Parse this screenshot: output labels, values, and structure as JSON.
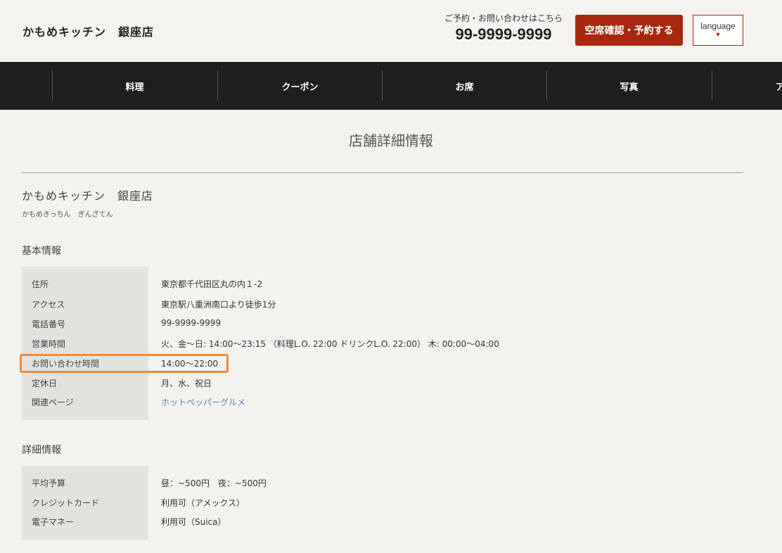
{
  "header": {
    "logo": "かもめキッチン　銀座店",
    "contact_label": "ご予約・お問い合わせはこちら",
    "phone": "99-9999-9999",
    "reserve_label": "空席確認・予約する",
    "language_label": "language",
    "language_caret": "▼"
  },
  "nav": {
    "items": [
      {
        "label": "料理"
      },
      {
        "label": "クーポン"
      },
      {
        "label": "お席"
      },
      {
        "label": "写真"
      },
      {
        "label": "ア"
      }
    ]
  },
  "main": {
    "page_title": "店舗詳細情報",
    "shop_name": "かもめキッチン　銀座店",
    "shop_kana": "かもめきっちん　ぎんざてん",
    "basic": {
      "title": "基本情報",
      "rows": [
        {
          "label": "住所",
          "value": "東京都千代田区丸の内１-2"
        },
        {
          "label": "アクセス",
          "value": "東京駅八重洲南口より徒歩1分"
        },
        {
          "label": "電話番号",
          "value": "99-9999-9999"
        },
        {
          "label": "営業時間",
          "value": "火、金〜日: 14:00〜23:15 （料理L.O. 22:00 ドリンクL.O. 22:00） 木: 00:00〜04:00"
        },
        {
          "label": "お問い合わせ時間",
          "value": "14:00〜22:00"
        },
        {
          "label": "定休日",
          "value": "月、水、祝日"
        },
        {
          "label": "関連ページ",
          "value": "ホットペッパーグルメ"
        }
      ]
    },
    "detail": {
      "title": "詳細情報",
      "rows": [
        {
          "label": "平均予算",
          "value": "昼：~500円　夜：~500円"
        },
        {
          "label": "クレジットカード",
          "value": "利用可（アメックス）"
        },
        {
          "label": "電子マネー",
          "value": "利用可（Suica）"
        }
      ]
    }
  },
  "colors": {
    "accent": "#a8280f",
    "highlight": "#f28a3c",
    "link": "#5a7fb0"
  }
}
